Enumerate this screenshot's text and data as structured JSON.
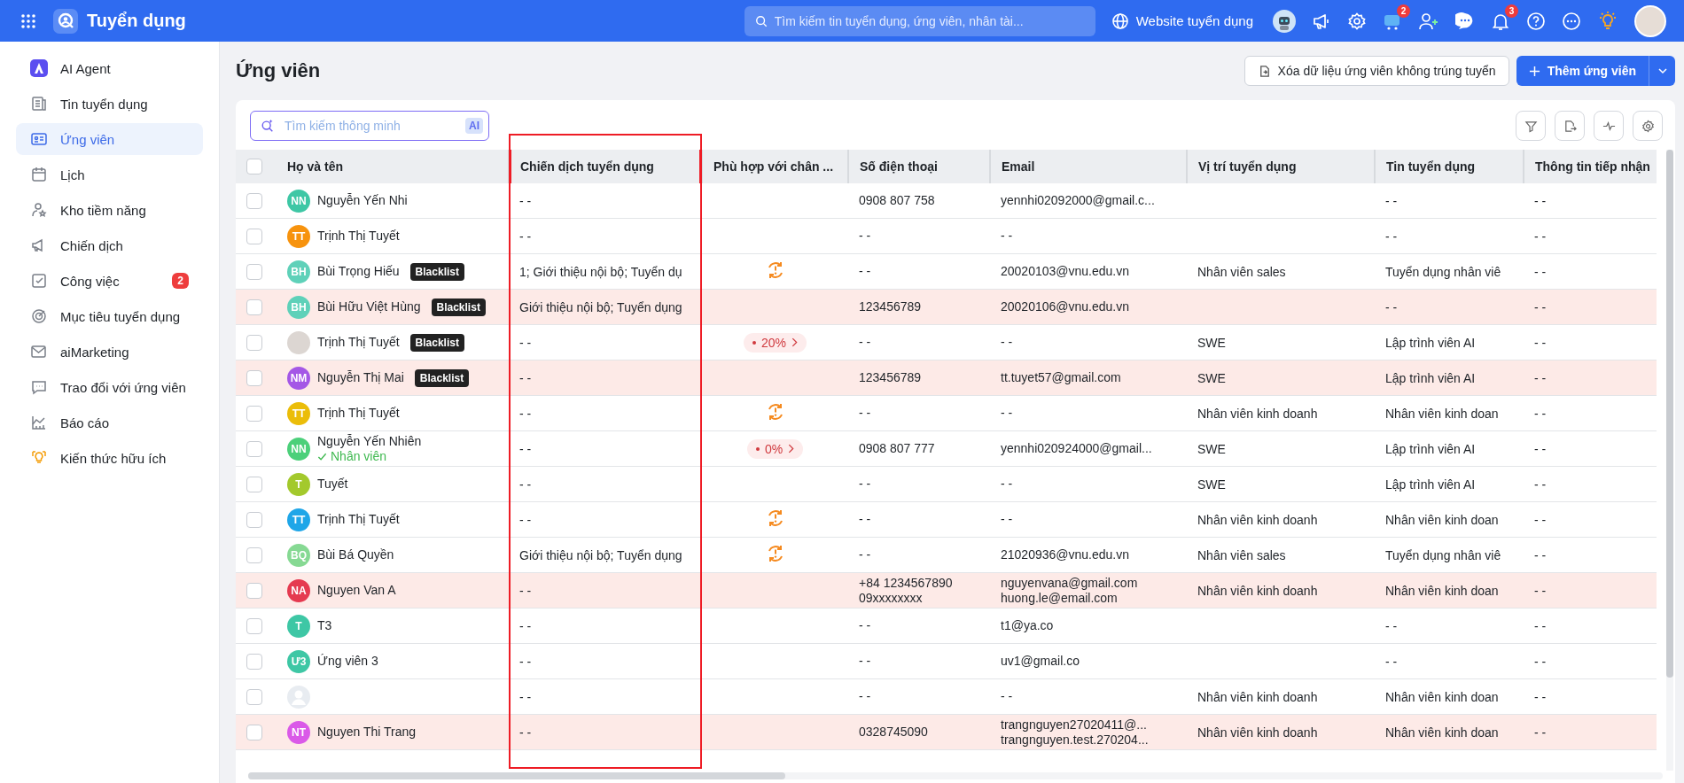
{
  "topbar": {
    "app_title": "Tuyển dụng",
    "search_placeholder": "Tìm kiếm tin tuyển dụng, ứng viên, nhân tài...",
    "website_link": "Website tuyển dụng",
    "cart_badge": "2",
    "bell_badge": "3"
  },
  "sidebar": {
    "items": [
      {
        "label": "AI Agent",
        "selected": false
      },
      {
        "label": "Tin tuyển dụng",
        "selected": false
      },
      {
        "label": "Ứng viên",
        "selected": true
      },
      {
        "label": "Lịch",
        "selected": false
      },
      {
        "label": "Kho tiềm năng",
        "selected": false
      },
      {
        "label": "Chiến dịch",
        "selected": false
      },
      {
        "label": "Công việc",
        "selected": false,
        "badge": "2"
      },
      {
        "label": "Mục tiêu tuyển dụng",
        "selected": false
      },
      {
        "label": "aiMarketing",
        "selected": false
      },
      {
        "label": "Trao đổi với ứng viên",
        "selected": false
      },
      {
        "label": "Báo cáo",
        "selected": false
      },
      {
        "label": "Kiến thức hữu ích",
        "selected": false
      }
    ]
  },
  "page": {
    "title": "Ứng viên",
    "clear_button": "Xóa dữ liệu ứng viên không trúng tuyển",
    "add_button": "Thêm ứng viên"
  },
  "smart_search": {
    "placeholder": "Tìm kiếm thông minh",
    "ai_tag": "AI"
  },
  "table": {
    "select_all_checked": false,
    "columns": [
      {
        "label": "Họ và tên",
        "highlighted": false
      },
      {
        "label": "Chiến dịch tuyển dụng",
        "highlighted": true
      },
      {
        "label": "Phù hợp với chân ...",
        "highlighted": false
      },
      {
        "label": "Số điện thoại",
        "highlighted": false
      },
      {
        "label": "Email",
        "highlighted": false
      },
      {
        "label": "Vị trí tuyển dụng",
        "highlighted": false
      },
      {
        "label": "Tin tuyển dụng",
        "highlighted": false
      },
      {
        "label": "Thông tin tiếp nhận",
        "highlighted": false
      }
    ],
    "rows": [
      {
        "avatar": {
          "kind": "initials",
          "text": "NN",
          "color": "#3ec7a5"
        },
        "name": "Nguyễn Yến Nhi",
        "flagged": false,
        "campaign": "- -",
        "match": {
          "kind": "none"
        },
        "phone": [
          "0908 807 758"
        ],
        "email": [
          "yennhi02092000@gmail.c..."
        ],
        "job_post": "- -",
        "intake": "- -"
      },
      {
        "avatar": {
          "kind": "initials",
          "text": "TT",
          "color": "#f7930e"
        },
        "name": "Trịnh Thị Tuyết",
        "flagged": false,
        "campaign": "- -",
        "match": {
          "kind": "none"
        },
        "phone": [
          "- -"
        ],
        "email": [
          "- -"
        ],
        "job_post": "- -",
        "intake": "- -"
      },
      {
        "avatar": {
          "kind": "initials",
          "text": "BH",
          "color": "#5fd1b9"
        },
        "name": "Bùi Trọng Hiếu",
        "tag": "Blacklist",
        "flagged": false,
        "campaign": "1; Giới thiệu nội bộ; Tuyển dụ",
        "match": {
          "kind": "warning"
        },
        "phone": [
          "- -"
        ],
        "email": [
          "20020103@vnu.edu.vn"
        ],
        "position": "Nhân viên sales",
        "job_post": "Tuyển dụng nhân viê",
        "intake": "- -"
      },
      {
        "avatar": {
          "kind": "initials",
          "text": "BH",
          "color": "#5fd1b9"
        },
        "name": "Bùi Hữu Việt Hùng",
        "tag": "Blacklist",
        "flagged": true,
        "campaign": "Giới thiệu nội bộ; Tuyển dụng",
        "match": {
          "kind": "none"
        },
        "phone": [
          "123456789"
        ],
        "email": [
          "20020106@vnu.edu.vn"
        ],
        "job_post": "- -",
        "intake": "- -"
      },
      {
        "avatar": {
          "kind": "photo"
        },
        "name": "Trịnh Thị Tuyết",
        "tag": "Blacklist",
        "flagged": false,
        "campaign": "- -",
        "match": {
          "kind": "percent",
          "text": "20%"
        },
        "phone": [
          "- -"
        ],
        "email": [
          "- -"
        ],
        "position": "SWE",
        "job_post": "Lập trình viên AI",
        "intake": "- -"
      },
      {
        "avatar": {
          "kind": "initials",
          "text": "NM",
          "color": "#a457e6"
        },
        "name": "Nguyễn Thị Mai",
        "tag": "Blacklist",
        "flagged": true,
        "campaign": "- -",
        "match": {
          "kind": "none"
        },
        "phone": [
          "123456789"
        ],
        "email": [
          "tt.tuyet57@gmail.com"
        ],
        "position": "SWE",
        "job_post": "Lập trình viên AI",
        "intake": "- -"
      },
      {
        "avatar": {
          "kind": "initials",
          "text": "TT",
          "color": "#ebbd09"
        },
        "name": "Trịnh Thị Tuyết",
        "flagged": false,
        "campaign": "- -",
        "match": {
          "kind": "warning"
        },
        "phone": [
          "- -"
        ],
        "email": [
          "- -"
        ],
        "position": "Nhân viên kinh doanh",
        "job_post": "Nhân viên kinh doan",
        "intake": "- -"
      },
      {
        "avatar": {
          "kind": "initials",
          "text": "NN",
          "color": "#4cd07a"
        },
        "name": "Nguyễn Yến Nhiên",
        "status": "Nhân viên",
        "flagged": false,
        "campaign": "- -",
        "match": {
          "kind": "percent",
          "text": "0%"
        },
        "phone": [
          "0908 807 777"
        ],
        "email": [
          "yennhi020924000@gmail..."
        ],
        "position": "SWE",
        "job_post": "Lập trình viên AI",
        "intake": "- -"
      },
      {
        "avatar": {
          "kind": "initials",
          "text": "T",
          "color": "#a3c92c"
        },
        "name": "Tuyết",
        "flagged": false,
        "campaign": "- -",
        "match": {
          "kind": "none"
        },
        "phone": [
          "- -"
        ],
        "email": [
          "- -"
        ],
        "position": "SWE",
        "job_post": "Lập trình viên AI",
        "intake": "- -"
      },
      {
        "avatar": {
          "kind": "initials",
          "text": "TT",
          "color": "#1fa6e8"
        },
        "name": "Trịnh Thị Tuyết",
        "flagged": false,
        "campaign": "- -",
        "match": {
          "kind": "warning"
        },
        "phone": [
          "- -"
        ],
        "email": [
          "- -"
        ],
        "position": "Nhân viên kinh doanh",
        "job_post": "Nhân viên kinh doan",
        "intake": "- -"
      },
      {
        "avatar": {
          "kind": "initials",
          "text": "BQ",
          "color": "#86d993"
        },
        "name": "Bùi Bá Quyền",
        "flagged": false,
        "campaign": "Giới thiệu nội bộ; Tuyển dụng",
        "match": {
          "kind": "warning"
        },
        "phone": [
          "- -"
        ],
        "email": [
          "21020936@vnu.edu.vn"
        ],
        "position": "Nhân viên sales",
        "job_post": "Tuyển dụng nhân viê",
        "intake": "- -"
      },
      {
        "avatar": {
          "kind": "initials",
          "text": "NA",
          "color": "#e53a50"
        },
        "name": "Nguyen Van A",
        "flagged": true,
        "campaign": "- -",
        "match": {
          "kind": "none"
        },
        "phone": [
          "+84 1234567890",
          "09xxxxxxxx"
        ],
        "email": [
          "nguyenvana@gmail.com",
          "huong.le@email.com"
        ],
        "position": "Nhân viên kinh doanh",
        "job_post": "Nhân viên kinh doan",
        "intake": "- -"
      },
      {
        "avatar": {
          "kind": "initials",
          "text": "T",
          "color": "#3ec7a5"
        },
        "name": "T3",
        "flagged": false,
        "campaign": "- -",
        "match": {
          "kind": "none"
        },
        "phone": [
          "- -"
        ],
        "email": [
          "t1@ya.co"
        ],
        "job_post": "- -",
        "intake": "- -"
      },
      {
        "avatar": {
          "kind": "initials",
          "text": "Ư3",
          "color": "#3ec7a5"
        },
        "name": "Ứng viên 3",
        "flagged": false,
        "campaign": "- -",
        "match": {
          "kind": "none"
        },
        "phone": [
          "- -"
        ],
        "email": [
          "uv1@gmail.co"
        ],
        "job_post": "- -",
        "intake": "- -"
      },
      {
        "avatar": {
          "kind": "silhouette"
        },
        "flagged": false,
        "campaign": "- -",
        "match": {
          "kind": "none"
        },
        "phone": [
          "- -"
        ],
        "email": [
          "- -"
        ],
        "position": "Nhân viên kinh doanh",
        "job_post": "Nhân viên kinh doan",
        "intake": "- -"
      },
      {
        "avatar": {
          "kind": "initials",
          "text": "NT",
          "color": "#da5ae8"
        },
        "name": "Nguyen Thi Trang",
        "flagged": true,
        "campaign": "- -",
        "match": {
          "kind": "none"
        },
        "phone": [
          "0328745090"
        ],
        "email": [
          "trangnguyen27020411@...",
          "trangnguyen.test.270204..."
        ],
        "position": "Nhân viên kinh doanh",
        "job_post": "Nhân viên kinh doan",
        "intake": "- -"
      }
    ]
  }
}
